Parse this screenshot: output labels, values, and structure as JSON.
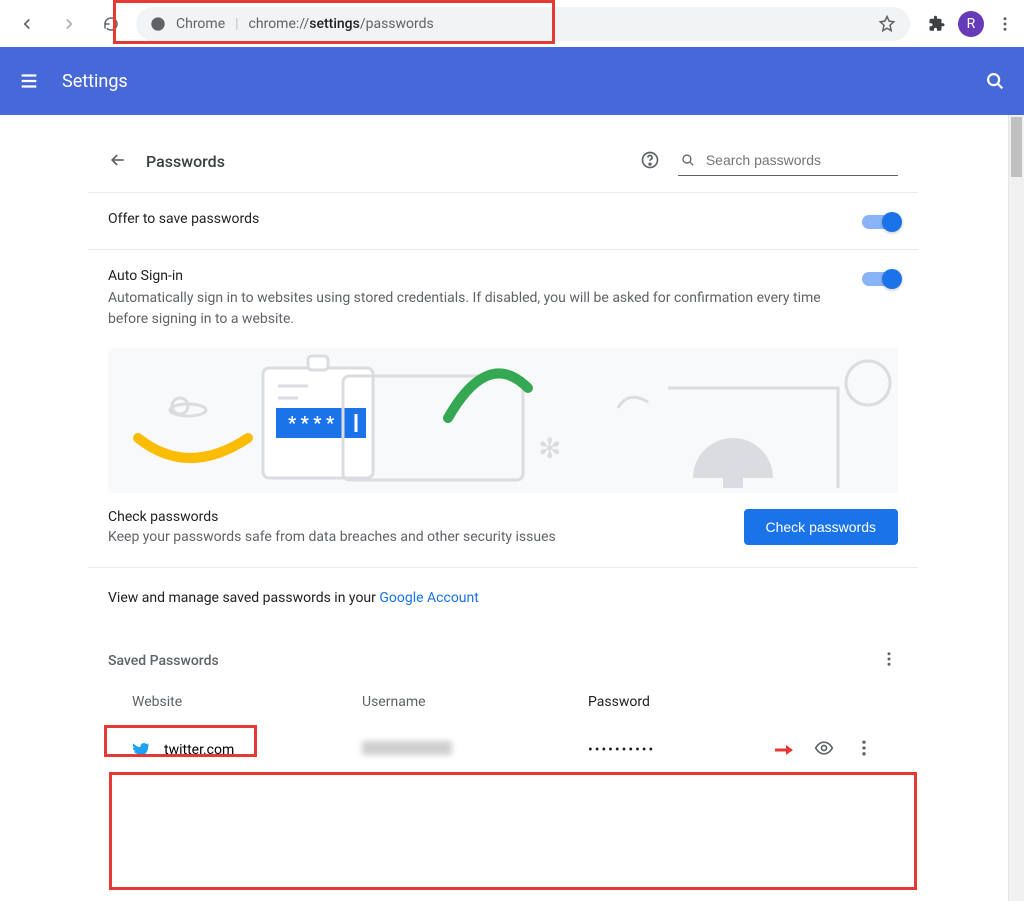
{
  "toolbar": {
    "url_prefix": "Chrome",
    "url_sep": " | ",
    "url_path1": "chrome://",
    "url_bold": "settings",
    "url_path2": "/passwords",
    "avatar_letter": "R"
  },
  "header": {
    "title": "Settings"
  },
  "page": {
    "title": "Passwords",
    "search_placeholder": "Search passwords"
  },
  "offer": {
    "label": "Offer to save passwords"
  },
  "autosignin": {
    "title": "Auto Sign-in",
    "desc": "Automatically sign in to websites using stored credentials. If disabled, you will be asked for confirmation every time before signing in to a website."
  },
  "check": {
    "title": "Check passwords",
    "desc": "Keep your passwords safe from data breaches and other security issues",
    "button": "Check passwords"
  },
  "linkline": {
    "prefix": "View and manage saved passwords in your ",
    "link": "Google Account"
  },
  "saved": {
    "heading": "Saved Passwords",
    "cols": {
      "site": "Website",
      "user": "Username",
      "pass": "Password"
    },
    "rows": [
      {
        "site": "twitter.com",
        "password_mask": "••••••••••"
      }
    ]
  }
}
